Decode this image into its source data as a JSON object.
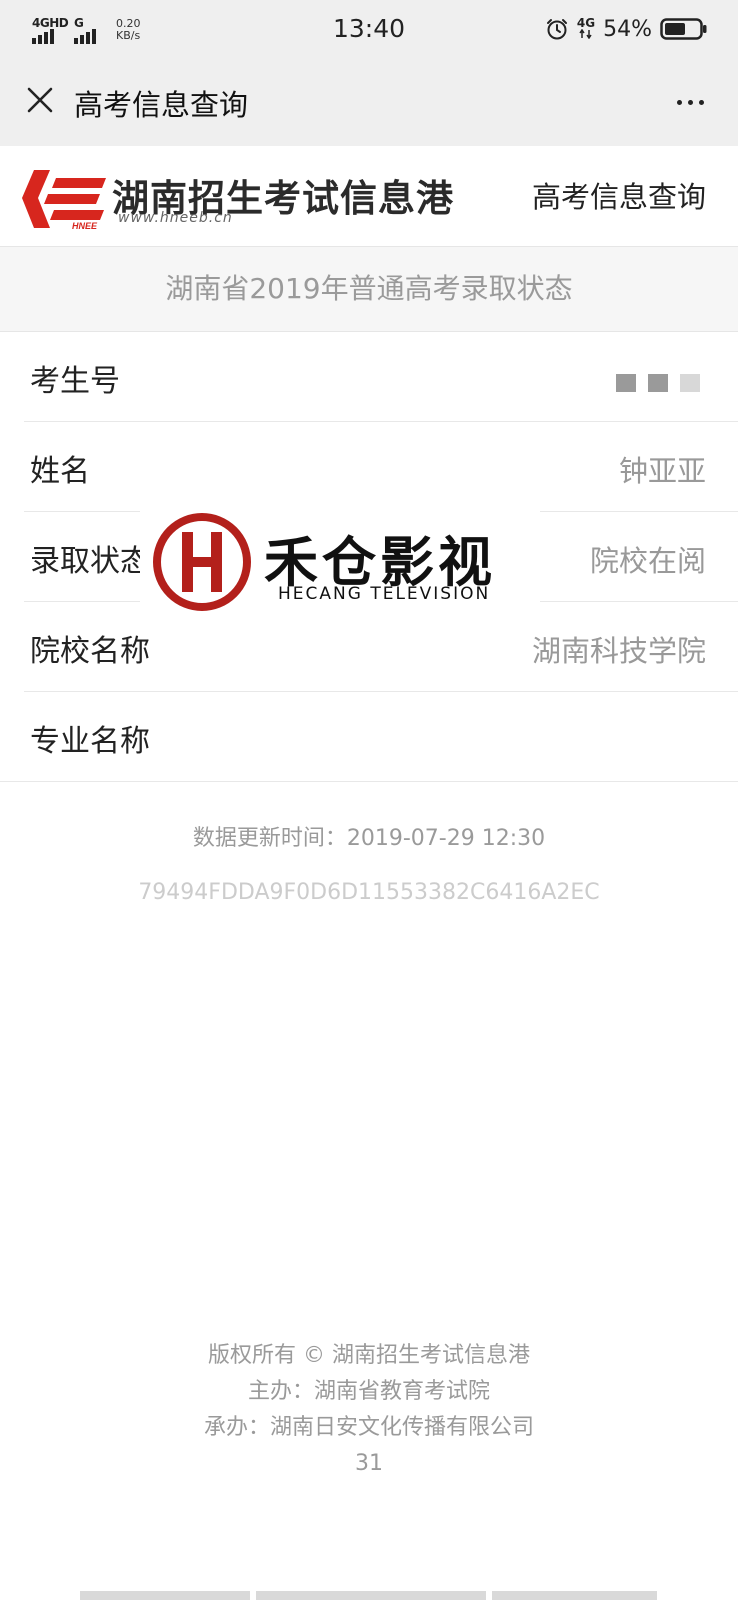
{
  "status_bar": {
    "network1": "4GHD",
    "network2": "G",
    "speed_value": "0.20",
    "speed_unit": "KB/s",
    "time": "13:40",
    "network3": "4G",
    "battery": "54%"
  },
  "title_bar": {
    "title": "高考信息查询"
  },
  "site_header": {
    "logo_name": "湖南招生考试信息港",
    "logo_url": "www.hneeb.cn",
    "logo_badge": "HNEE",
    "link": "高考信息查询"
  },
  "page": {
    "heading": "湖南省2019年普通高考录取状态"
  },
  "info": [
    {
      "label": "考生号",
      "value": ""
    },
    {
      "label": "姓名",
      "value": "钟亚亚"
    },
    {
      "label": "录取状态",
      "value": "院校在阅"
    },
    {
      "label": "院校名称",
      "value": "湖南科技学院"
    },
    {
      "label": "专业名称",
      "value": ""
    }
  ],
  "watermark": {
    "cn": "禾仓影视",
    "en": "HECANG TELEVISION"
  },
  "meta": {
    "update_time": "数据更新时间：2019-07-29 12:30",
    "hash": "79494FDDA9F0D6D11553382C6416A2EC"
  },
  "footer": {
    "copyright": "版权所有 © 湖南招生考试信息港",
    "host": "主办：湖南省教育考试院",
    "operator": "承办：湖南日安文化传播有限公司",
    "number": "31"
  },
  "colors": {
    "brand_red": "#d7261e",
    "watermark_red": "#b3201b",
    "muted_text": "#9a9a9a"
  }
}
